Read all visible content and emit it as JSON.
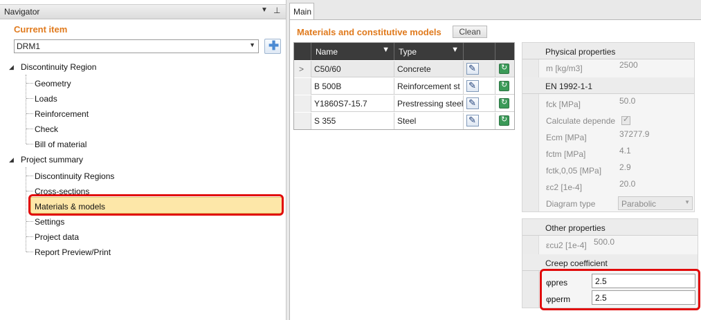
{
  "navigator": {
    "title": "Navigator",
    "current_item_label": "Current item",
    "current_item_value": "DRM1",
    "tree": [
      {
        "label": "Discontinuity Region",
        "children": [
          "Geometry",
          "Loads",
          "Reinforcement",
          "Check",
          "Bill of material"
        ]
      },
      {
        "label": "Project summary",
        "children": [
          "Discontinuity Regions",
          "Cross-sections",
          "Materials & models",
          "Settings",
          "Project data",
          "Report Preview/Print"
        ]
      }
    ],
    "selected": "Materials & models"
  },
  "tabs": [
    "Main"
  ],
  "materials": {
    "title": "Materials and constitutive models",
    "clean_label": "Clean",
    "columns": [
      "Name",
      "Type"
    ],
    "rows": [
      {
        "name": "C50/60",
        "type": "Concrete"
      },
      {
        "name": "B 500B",
        "type": "Reinforcement st"
      },
      {
        "name": "Y1860S7-15.7",
        "type": "Prestressing steel"
      },
      {
        "name": "S 355",
        "type": "Steel"
      }
    ]
  },
  "properties": {
    "physical": {
      "title": "Physical properties",
      "rows": [
        {
          "label": "m [kg/m3]",
          "value": "2500"
        }
      ]
    },
    "code": {
      "title": "EN 1992-1-1",
      "rows": [
        {
          "label": "fck [MPa]",
          "value": "50.0"
        },
        {
          "label": "Calculate depende",
          "value": ""
        },
        {
          "label": "Ecm [MPa]",
          "value": "37277.9"
        },
        {
          "label": "fctm [MPa]",
          "value": "4.1"
        },
        {
          "label": "fctk,0,05 [MPa]",
          "value": "2.9"
        },
        {
          "label": "εc2 [1e-4]",
          "value": "20.0"
        },
        {
          "label": "Diagram type",
          "value": "Parabolic"
        }
      ]
    },
    "other": {
      "title": "Other properties",
      "rows": [
        {
          "label": "εcu2 [1e-4]",
          "value": "500.0"
        }
      ]
    },
    "creep": {
      "title": "Creep coefficient",
      "rows": [
        {
          "label": "φpres",
          "value": "2.5"
        },
        {
          "label": "φperm",
          "value": "2.5"
        }
      ]
    }
  },
  "colors": {
    "accent": "#e07a1d",
    "highlight": "#e10a0a",
    "selected": "#fde7a8"
  }
}
